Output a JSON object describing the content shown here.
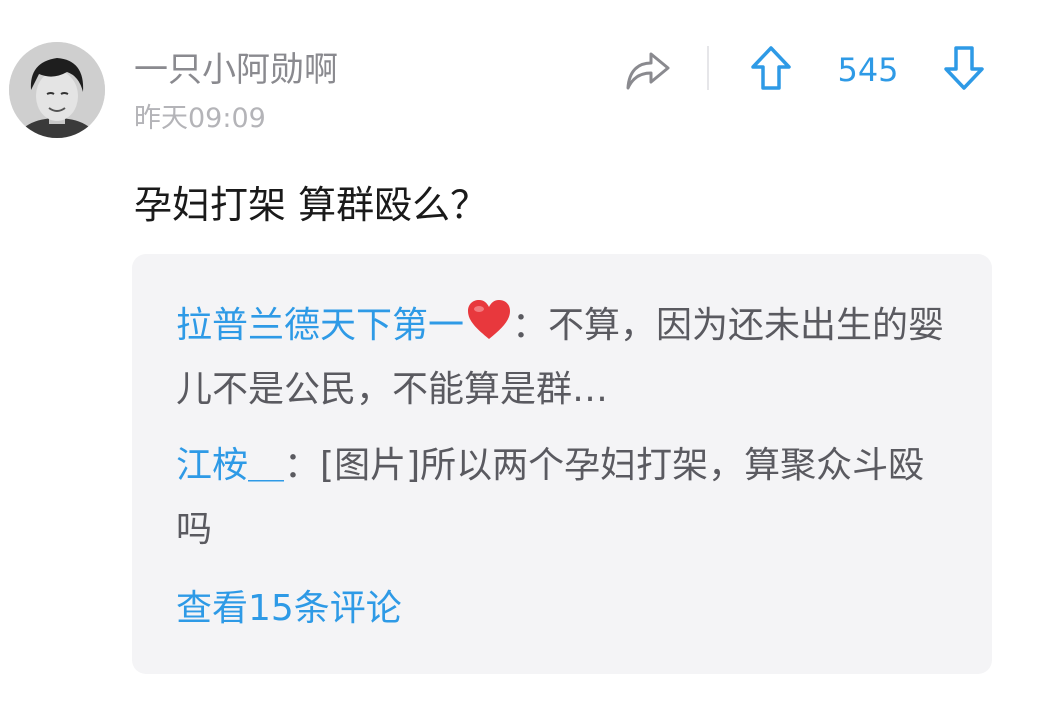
{
  "post": {
    "author": "一只小阿勋啊",
    "time": "昨天09:09",
    "content": "孕妇打架 算群殴么？",
    "votes": "545"
  },
  "icons": {
    "share": "share-arrow-icon",
    "upvote": "arrow-up-icon",
    "downvote": "arrow-down-icon",
    "heart": "heart-icon"
  },
  "colors": {
    "accent": "#2e9ae6",
    "heart": "#e8383d"
  },
  "comments": [
    {
      "author": "拉普兰德天下第一",
      "separator": "：",
      "text": "不算，因为还未出生的婴儿不是公民，不能算是群…"
    },
    {
      "author": "江桉＿",
      "separator": "：",
      "text": "[图片]所以两个孕妇打架，算聚众斗殴吗"
    }
  ],
  "view_more": "查看15条评论"
}
